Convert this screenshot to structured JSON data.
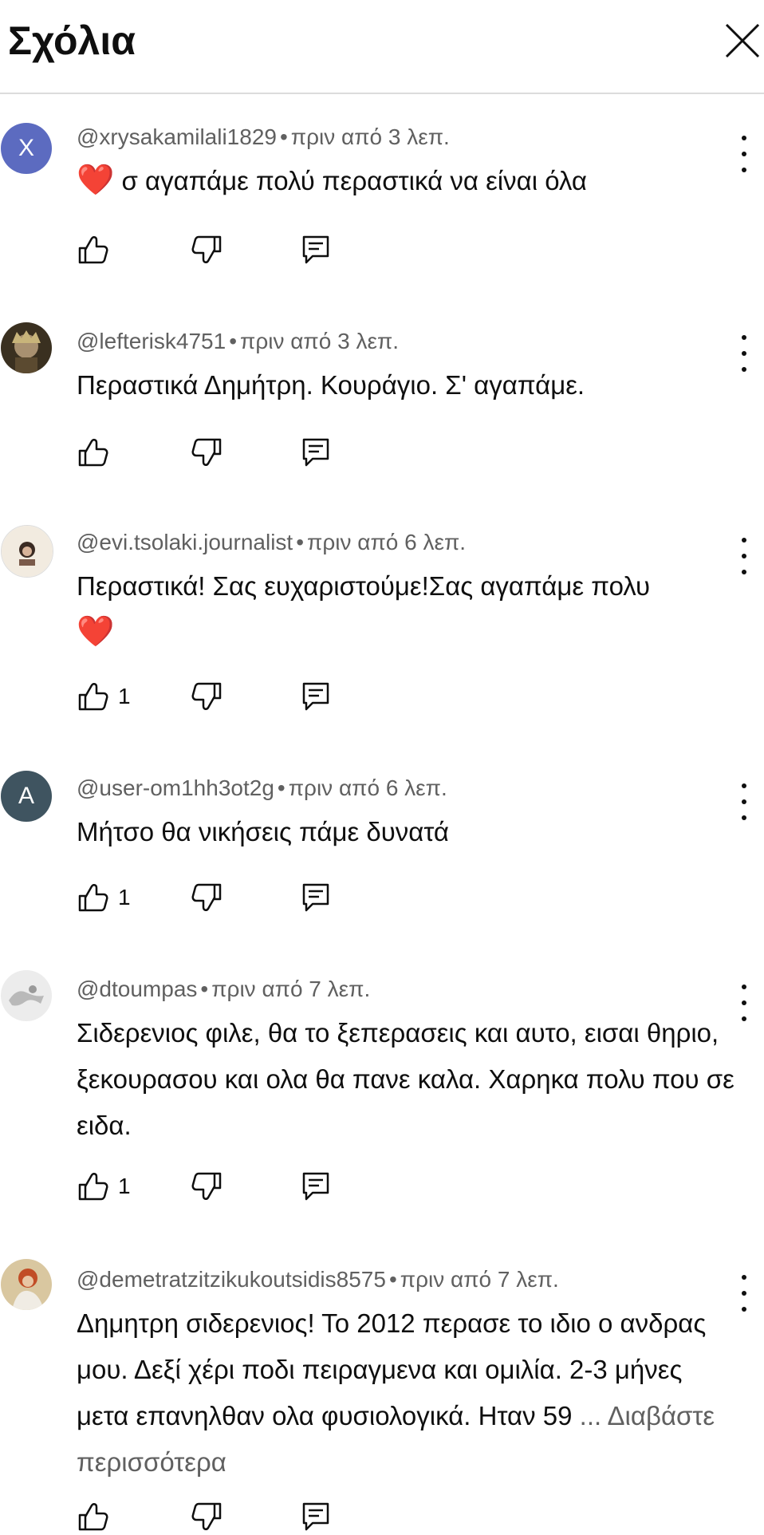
{
  "header": {
    "title": "Σχόλια",
    "close_icon": "close-icon"
  },
  "comments": [
    {
      "user": "@xrysakamilali1829",
      "time": "πριν από 3 λεπ.",
      "lead_emoji": "❤️",
      "text": "σ αγαπάμε πολύ περαστικά να είναι όλα",
      "likes": "",
      "avatar_letter": "X",
      "avatar_color": "#5c6bc0"
    },
    {
      "user": "@lefterisk4751",
      "time": "πριν από 3 λεπ.",
      "text": "Περαστικά Δημήτρη. Κουράγιο. Σ' αγαπάμε.",
      "likes": "",
      "avatar_letter": "",
      "avatar_color": "#6b5a3a"
    },
    {
      "user": "@evi.tsolaki.journalist",
      "time": "πριν από 6 λεπ.",
      "text": "Περαστικά! Σας ευχαριστούμε!Σας αγαπάμε πολυ",
      "trail_emoji": "❤️",
      "likes": "1",
      "avatar_letter": "",
      "avatar_color": "#efe6d8"
    },
    {
      "user": "@user-om1hh3ot2g",
      "time": "πριν από 6 λεπ.",
      "text": "Μήτσο θα νικήσεις πάμε δυνατά",
      "likes": "1",
      "avatar_letter": "A",
      "avatar_color": "#3f5460"
    },
    {
      "user": "@dtoumpas",
      "time": "πριν από 7 λεπ.",
      "text": "Σιδερενιος φιλε, θα το ξεπερασεις και αυτο, εισαι θηριο, ξεκουρασου και ολα θα πανε καλα. Χαρηκα πολυ που σε ειδα.",
      "likes": "1",
      "avatar_letter": "",
      "avatar_color": "#e6e6e6"
    },
    {
      "user": "@demetratzitzikukoutsidis8575",
      "time": "πριν από 7 λεπ.",
      "text": "Δημητρη σιδερενιος! Το 2012 περασε το ιδιο ο ανδρας μου. Δεξί χέρι ποδι πειραγμενα και ομιλία. 2-3 μήνες μετα επανηλθαν ολα φυσιολογικά. Ηταν 59",
      "more": "... Διαβάστε περισσότερα",
      "likes": "",
      "avatar_letter": "",
      "avatar_color": "#c9623a"
    }
  ],
  "icons": {
    "like": "thumb-up-icon",
    "dislike": "thumb-down-icon",
    "reply": "reply-icon",
    "menu": "more-vert-icon"
  }
}
